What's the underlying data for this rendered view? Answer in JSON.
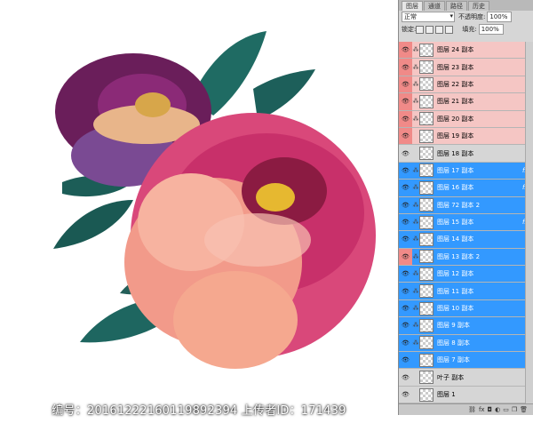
{
  "panel": {
    "tabs": [
      "图层",
      "通道",
      "路径",
      "历史"
    ],
    "blend_mode": "正常",
    "opacity_label": "不透明度:",
    "opacity_value": "100%",
    "lock_label": "锁定:",
    "fill_label": "填充:",
    "fill_value": "100%",
    "layers": [
      {
        "name": "图层 24 副本",
        "state": "pink",
        "linked": true,
        "fx": false
      },
      {
        "name": "图层 23 副本",
        "state": "pink",
        "linked": true,
        "fx": false
      },
      {
        "name": "图层 22 副本",
        "state": "pink",
        "linked": true,
        "fx": false
      },
      {
        "name": "图层 21 副本",
        "state": "pink",
        "linked": true,
        "fx": false
      },
      {
        "name": "图层 20 副本",
        "state": "pink",
        "linked": true,
        "fx": false
      },
      {
        "name": "图层 19 副本",
        "state": "pink",
        "linked": false,
        "fx": false
      },
      {
        "name": "图层 18 副本",
        "state": "normal",
        "linked": false,
        "fx": false
      },
      {
        "name": "图层 17 副本",
        "state": "selected",
        "linked": true,
        "fx": true
      },
      {
        "name": "图层 16 副本",
        "state": "selected",
        "linked": true,
        "fx": true
      },
      {
        "name": "图层 72 副本 2",
        "state": "selected",
        "linked": true,
        "fx": false
      },
      {
        "name": "图层 15 副本",
        "state": "selected",
        "linked": true,
        "fx": true
      },
      {
        "name": "图层 14 副本",
        "state": "selected",
        "linked": true,
        "fx": false
      },
      {
        "name": "图层 13 副本 2",
        "state": "selected",
        "linked": true,
        "fx": false
      },
      {
        "name": "图层 12 副本",
        "state": "selected",
        "linked": true,
        "fx": false
      },
      {
        "name": "图层 11 副本",
        "state": "selected",
        "linked": true,
        "fx": false
      },
      {
        "name": "图层 10 副本",
        "state": "selected",
        "linked": true,
        "fx": false
      },
      {
        "name": "图层 9 副本",
        "state": "selected",
        "linked": true,
        "fx": false
      },
      {
        "name": "图层 8 副本",
        "state": "selected",
        "linked": true,
        "fx": false
      },
      {
        "name": "图层 7 副本",
        "state": "selected",
        "linked": false,
        "fx": false
      },
      {
        "name": "叶子 副本",
        "state": "normal",
        "linked": false,
        "fx": false
      },
      {
        "name": "图层 1",
        "state": "normal",
        "linked": false,
        "fx": false
      }
    ]
  },
  "footer": {
    "watermark": "编号：20161222160119892394 上传者ID：171439"
  },
  "colors": {
    "selected": "#3399ff",
    "pink_eye": "#f08a88",
    "panel_bg": "#d6d6d6"
  }
}
